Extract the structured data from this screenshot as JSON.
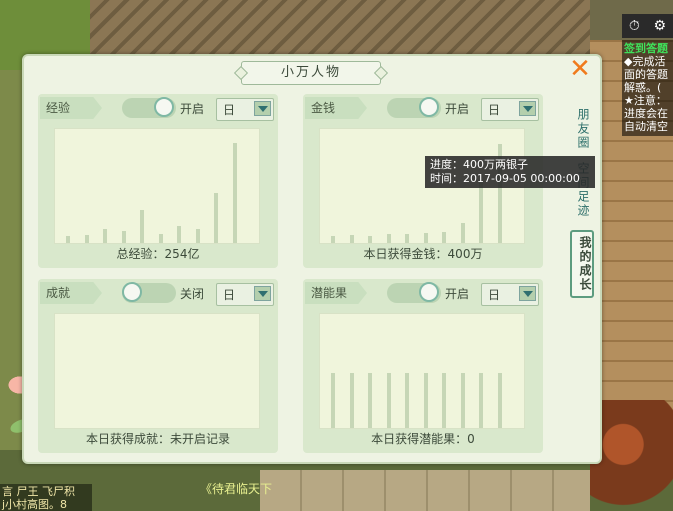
{
  "hud": {
    "stopwatch_icon": "⏱",
    "gear_icon": "⚙"
  },
  "quest": {
    "title": "签到答题",
    "lines": [
      "◆完成活",
      "面的答题",
      "解惑。(",
      "★注意：",
      "进度会在",
      "自动清空"
    ]
  },
  "chat": {
    "line1": "言 尸王 飞尸积",
    "line2": "j小村高图。8"
  },
  "world_text": "《待君临天下",
  "panel": {
    "title": "小万人物",
    "close_label": "✕",
    "side_tabs": [
      "朋友圈",
      "空间足迹",
      "我的成长"
    ],
    "active_tab": 2
  },
  "sections": [
    {
      "label": "经验",
      "toggle_on": true,
      "toggle_label": "开启",
      "period": "日",
      "caption": "总经验：254亿",
      "bars": [
        0.06,
        0.07,
        0.13,
        0.11,
        0.3,
        0.08,
        0.15,
        0.13,
        0.45,
        0.91
      ]
    },
    {
      "label": "金钱",
      "toggle_on": true,
      "toggle_label": "开启",
      "period": "日",
      "caption": "本日获得金钱：400万",
      "bars": [
        0.06,
        0.07,
        0.06,
        0.08,
        0.08,
        0.09,
        0.1,
        0.18,
        0.55,
        0.9
      ]
    },
    {
      "label": "成就",
      "toggle_on": false,
      "toggle_label": "关闭",
      "period": "日",
      "caption": "本日获得成就：未开启记录",
      "bars": []
    },
    {
      "label": "潜能果",
      "toggle_on": true,
      "toggle_label": "开启",
      "period": "日",
      "caption": "本日获得潜能果：0",
      "bars": [
        0.5,
        0.5,
        0.5,
        0.5,
        0.5,
        0.5,
        0.5,
        0.5,
        0.5,
        0.5
      ]
    }
  ],
  "tooltip": {
    "progress": "进度：400万两银子",
    "time": "时间：2017-09-05 00:00:00"
  }
}
